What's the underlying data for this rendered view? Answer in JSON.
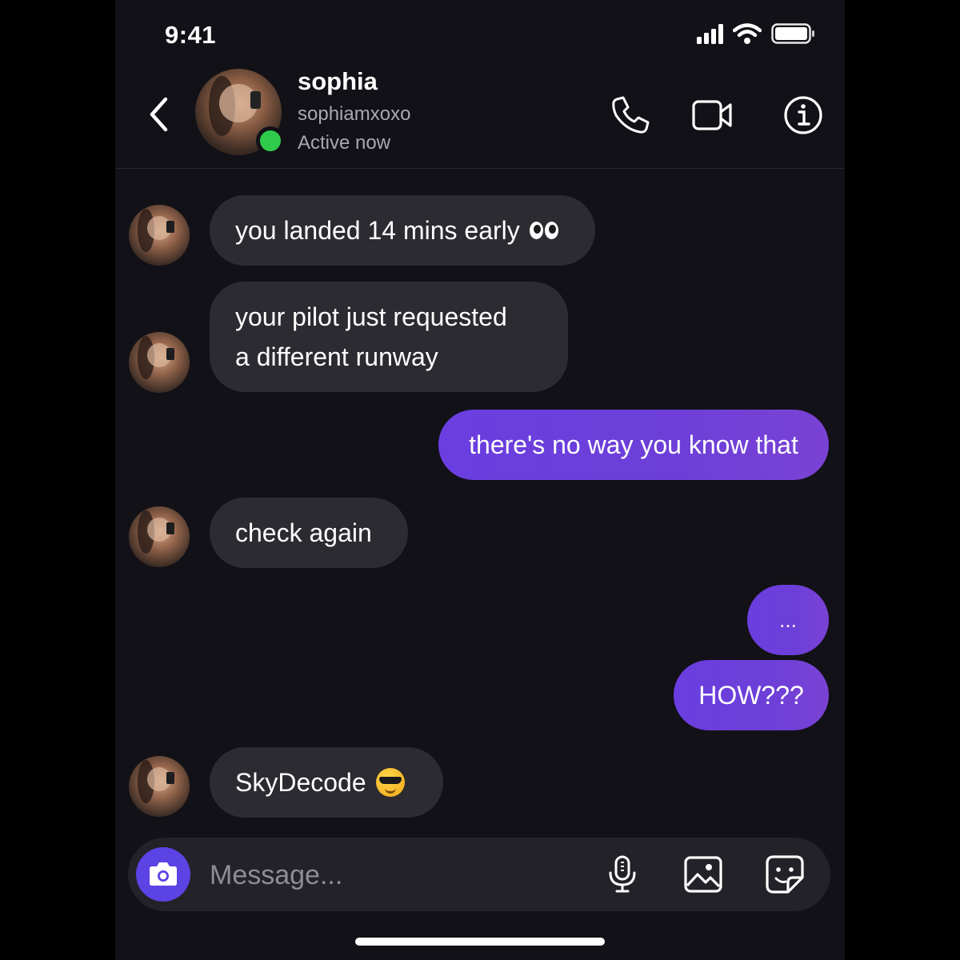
{
  "status_bar": {
    "time": "9:41"
  },
  "header": {
    "contact_name": "sophia",
    "contact_handle": "sophiamxoxo",
    "contact_status": "Active now",
    "icons": [
      "back-icon",
      "phone-icon",
      "video-icon",
      "info-icon"
    ]
  },
  "messages": [
    {
      "sender": "sophia",
      "text": "you landed 14 mins early",
      "emoji": "eyes"
    },
    {
      "sender": "sophia",
      "line1": "your pilot just requested",
      "line2": "a different runway"
    },
    {
      "sender": "me",
      "text": "there's no way you know that"
    },
    {
      "sender": "sophia",
      "text": "check again"
    },
    {
      "sender": "me",
      "text": "..."
    },
    {
      "sender": "me",
      "text": "HOW???"
    },
    {
      "sender": "sophia",
      "text": "SkyDecode",
      "emoji": "smiling-face-with-sunglasses"
    }
  ],
  "composer": {
    "placeholder": "Message...",
    "icons": [
      "camera-icon",
      "microphone-icon",
      "image-icon",
      "sticker-icon"
    ]
  },
  "colors": {
    "background": "#121117",
    "incoming_bubble": "#2c2b31",
    "outgoing_bubble": "#6a3ee0",
    "online": "#2fcb4b",
    "camera_button": "#5b43e4"
  }
}
